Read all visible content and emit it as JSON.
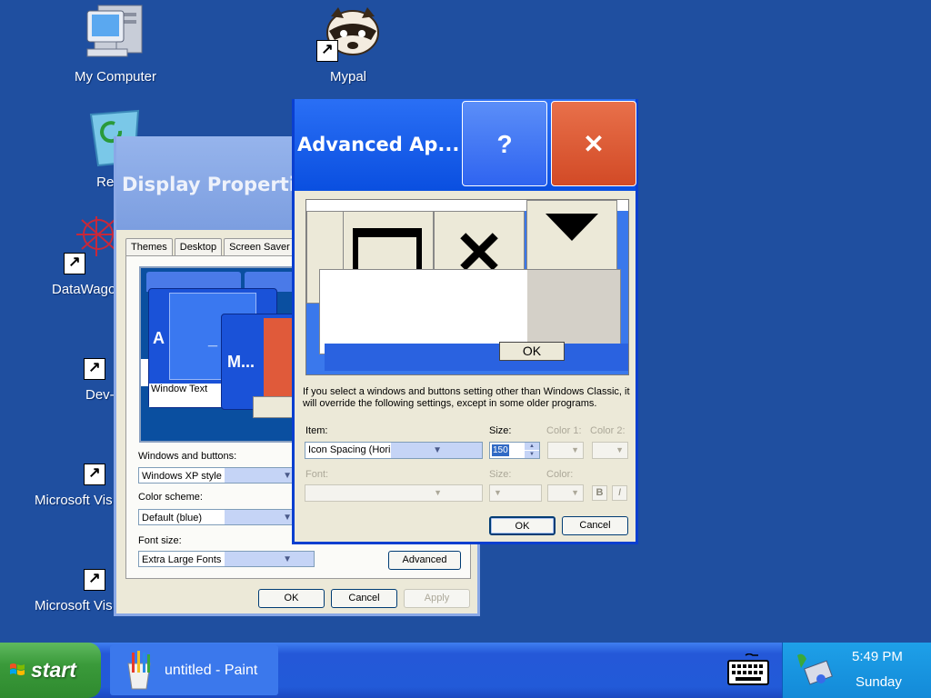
{
  "desktop": {
    "icons": [
      {
        "label": "My Computer",
        "icon": "my-computer-icon"
      },
      {
        "label": "Mypal",
        "icon": "raccoon-icon"
      },
      {
        "label": "Recyc",
        "icon": "recycle-bin-icon"
      },
      {
        "label": "DataWago",
        "icon": "datawagon-icon"
      },
      {
        "label": "Dev-",
        "icon": "dev-cpp-icon"
      },
      {
        "label": "Microsoft Vis",
        "icon": "visio-icon"
      },
      {
        "label": "Microsoft Vis",
        "icon": "visio-icon"
      }
    ]
  },
  "display_properties": {
    "title": "Display Properties",
    "tabs": [
      "Themes",
      "Desktop",
      "Screen Saver"
    ],
    "preview": {
      "active_title": "A",
      "min_glyph": "_",
      "inactive_title": "M...",
      "window_text": "Window Text"
    },
    "windows_buttons": {
      "label": "Windows and buttons:",
      "value": "Windows XP style"
    },
    "color_scheme": {
      "label": "Color scheme:",
      "value": "Default (blue)"
    },
    "font_size": {
      "label": "Font size:",
      "value": "Extra Large Fonts"
    },
    "advanced_label": "Advanced",
    "ok_label": "OK",
    "cancel_label": "Cancel",
    "apply_label": "Apply"
  },
  "advanced_appearance": {
    "title": "Advanced Ap...",
    "help_glyph": "?",
    "close_glyph": "✕",
    "preview": {
      "ok_label": "OK"
    },
    "description": "If you select a windows and buttons setting other than Windows Classic, it will override the following settings, except in some older programs.",
    "item_label": "Item:",
    "item_value": "Icon Spacing (Horiz",
    "size_label": "Size:",
    "size_value": "150",
    "color1_label": "Color 1:",
    "color2_label": "Color 2:",
    "font_label": "Font:",
    "font_size_label": "Size:",
    "font_color_label": "Color:",
    "bold_glyph": "B",
    "italic_glyph": "I",
    "ok_label": "OK",
    "cancel_label": "Cancel"
  },
  "taskbar": {
    "start_label": "start",
    "task_label": "untitled - Paint",
    "time": "5:49 PM",
    "day": "Sunday"
  },
  "colors": {
    "desktop": "#1f4fa0",
    "active_title": "#0a4fe0",
    "inactive_title": "#7c9ee0",
    "close_button": "#d24a26",
    "start_button": "#3a9a3a"
  }
}
